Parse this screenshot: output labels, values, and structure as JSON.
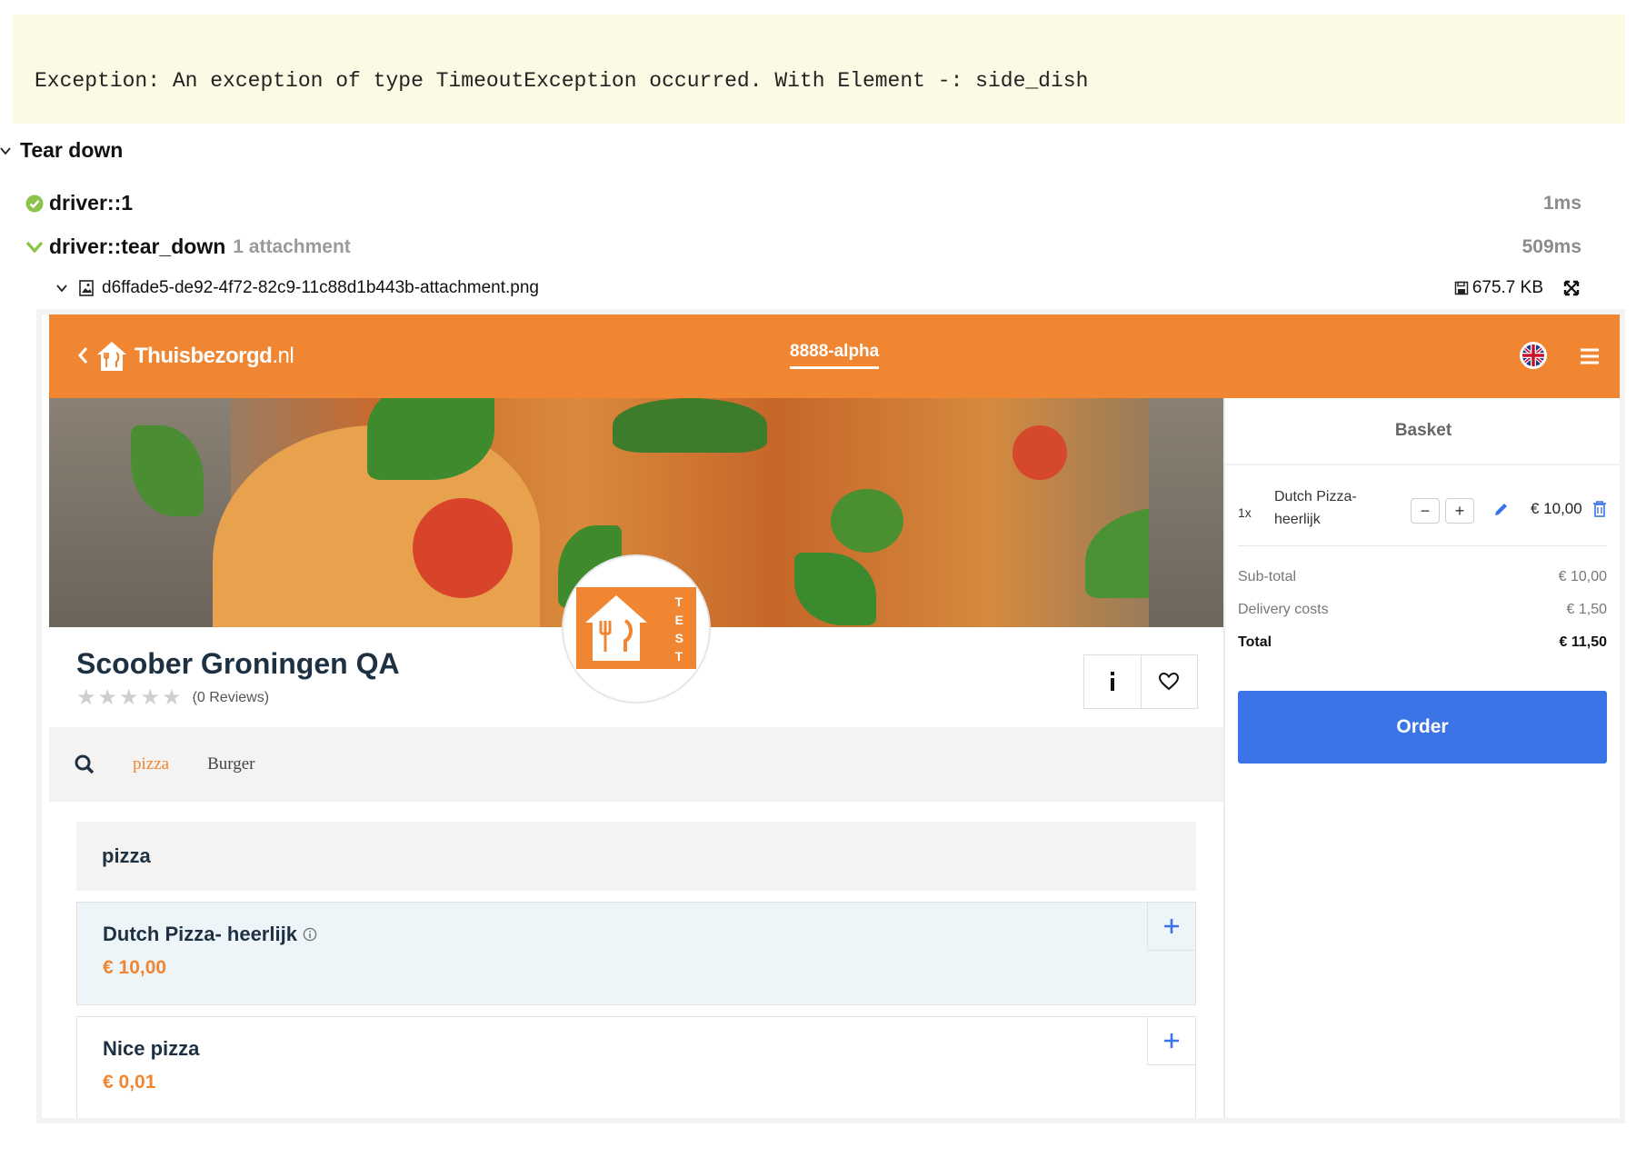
{
  "exception": {
    "message": "Exception: An exception of type TimeoutException occurred. With Element -: side_dish"
  },
  "teardown": {
    "title": "Tear down",
    "steps": [
      {
        "name": "driver::1",
        "duration": "1ms",
        "status": "passed"
      },
      {
        "name": "driver::tear_down",
        "extra": "1 attachment",
        "duration": "509ms"
      }
    ],
    "attachment": {
      "filename": "d6ffade5-de92-4f72-82c9-11c88d1b443b-attachment.png",
      "size": "675.7 KB"
    }
  },
  "screenshot": {
    "brand": {
      "name": "Thuisbezorgd",
      "suffix": ".nl",
      "color": "#f08632"
    },
    "env_label": "8888-alpha",
    "restaurant": {
      "name": "Scoober Groningen QA",
      "rating": 0,
      "reviews": "(0 Reviews)",
      "logo_text": [
        "T",
        "E",
        "S",
        "T"
      ]
    },
    "categories": [
      {
        "label": "pizza",
        "active": true
      },
      {
        "label": "Burger",
        "active": false
      }
    ],
    "section": {
      "title": "pizza"
    },
    "products": [
      {
        "name": "Dutch Pizza- heerlijk",
        "price": "€ 10,00",
        "highlighted": true
      },
      {
        "name": "Nice pizza",
        "price": "€ 0,01",
        "highlighted": false
      }
    ],
    "basket": {
      "title": "Basket",
      "item": {
        "qty": "1x",
        "name": "Dutch Pizza- heerlijk",
        "price": "€ 10,00",
        "minus": "−",
        "plus": "+"
      },
      "subtotal": {
        "label": "Sub-total",
        "value": "€ 10,00"
      },
      "delivery": {
        "label": "Delivery costs",
        "value": "€ 1,50"
      },
      "total": {
        "label": "Total",
        "value": "€ 11,50"
      },
      "order_label": "Order",
      "order_color": "#3b74e6"
    }
  }
}
